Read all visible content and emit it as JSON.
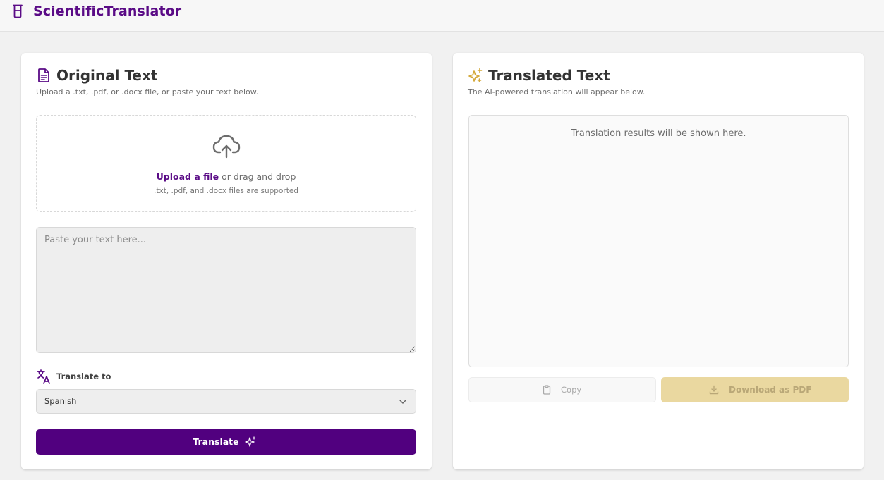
{
  "app": {
    "name": "ScientificTranslator",
    "logo_icon": "beaker-icon",
    "brand_color": "#5a0b86"
  },
  "original": {
    "title": "Original Text",
    "title_icon": "document-icon",
    "subtitle": "Upload a .txt, .pdf, or .docx file, or paste your text below.",
    "upload": {
      "icon": "cloud-upload-icon",
      "link_text": "Upload a file",
      "rest_text": " or drag and drop",
      "hint": ".txt, .pdf, and .docx files are supported"
    },
    "textarea_placeholder": "Paste your text here...",
    "textarea_value": "",
    "language": {
      "icon": "translate-icon",
      "label": "Translate to",
      "selected": "Spanish"
    },
    "translate_button": {
      "label": "Translate",
      "icon": "sparkles-icon",
      "color": "#51007f"
    }
  },
  "translated": {
    "title": "Translated Text",
    "title_icon": "sparkles-icon",
    "subtitle": "The AI-powered translation will appear below.",
    "placeholder": "Translation results will be shown here.",
    "copy_button": {
      "label": "Copy",
      "icon": "clipboard-icon"
    },
    "download_button": {
      "label": "Download as PDF",
      "icon": "download-icon",
      "color": "#ead8a0"
    }
  }
}
